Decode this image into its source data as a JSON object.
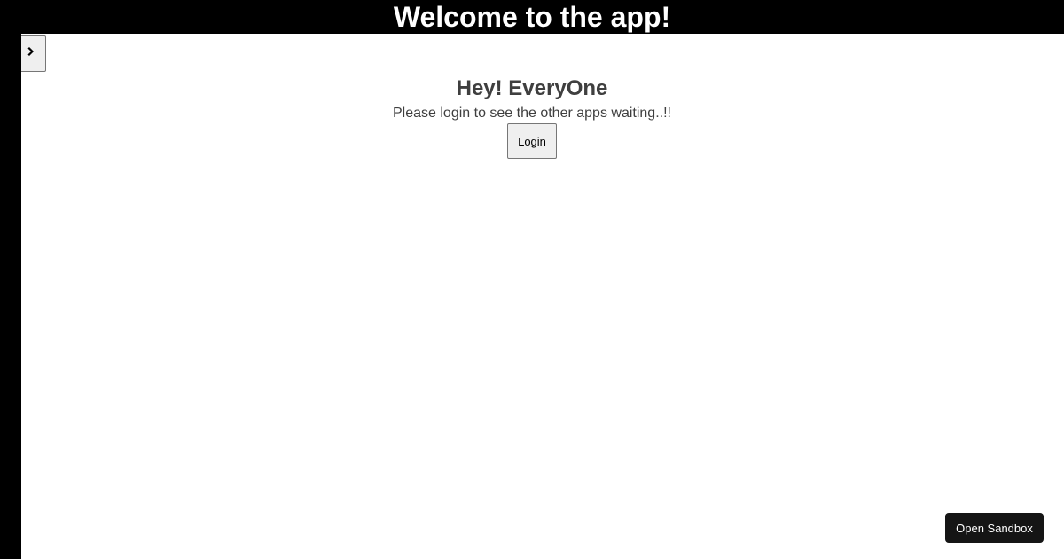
{
  "header": {
    "title": "Welcome to the app!"
  },
  "sidebar_toggle": {
    "icon": "chevron-right-icon"
  },
  "main": {
    "greeting": "Hey! EveryOne",
    "message": "Please login to see the other apps waiting..!!",
    "login_label": "Login"
  },
  "footer": {
    "sandbox_label": "Open Sandbox"
  },
  "colors": {
    "header_background": "#000000",
    "header_text": "#ffffff",
    "body_text": "#3f3f3f",
    "sandbox_button_background": "#151515"
  }
}
